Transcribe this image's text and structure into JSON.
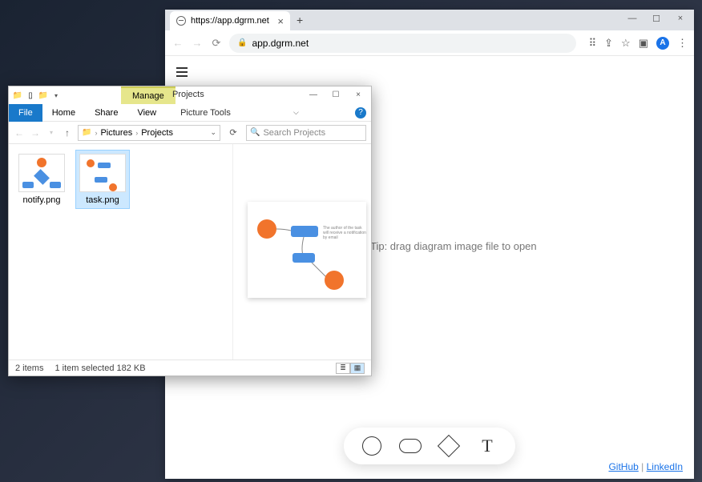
{
  "browser": {
    "tab_title": "https://app.dgrm.net",
    "url": "app.dgrm.net",
    "tip_text": "Tip: drag diagram image file to open",
    "footer": {
      "github": "GitHub",
      "linkedin": "LinkedIn",
      "sep": " | "
    },
    "avatar_letter": "A"
  },
  "explorer": {
    "context_tab": "Manage",
    "window_title": "Projects",
    "ribbon_tabs": {
      "file": "File",
      "home": "Home",
      "share": "Share",
      "view": "View",
      "picture_tools": "Picture Tools"
    },
    "breadcrumbs": [
      "Pictures",
      "Projects"
    ],
    "search_placeholder": "Search Projects",
    "files": [
      {
        "name": "notify.png",
        "selected": false
      },
      {
        "name": "task.png",
        "selected": true
      }
    ],
    "preview_caption": "The author of the task will receive a notification by email",
    "status": {
      "count": "2 items",
      "selection": "1 item selected  182 KB"
    }
  }
}
